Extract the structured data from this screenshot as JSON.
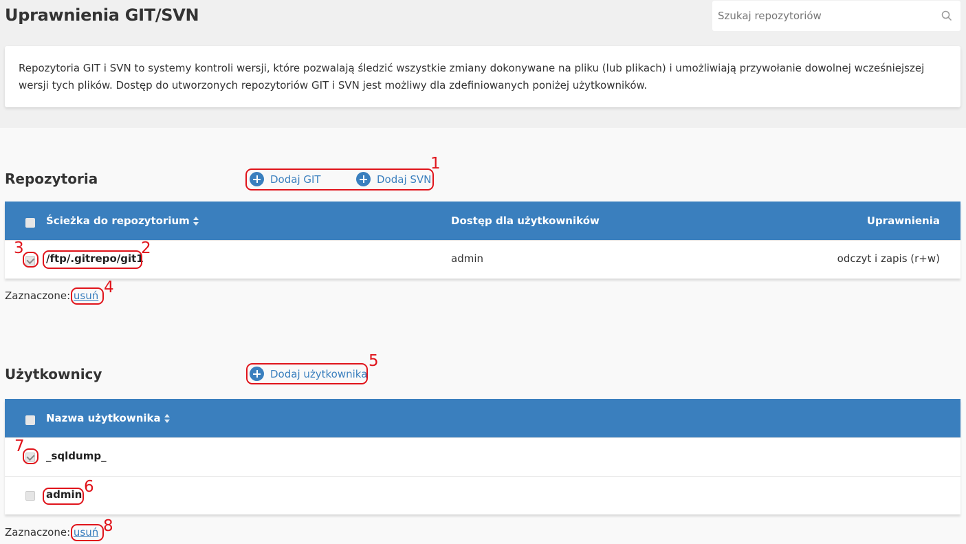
{
  "header": {
    "title": "Uprawnienia GIT/SVN",
    "search_placeholder": "Szukaj repozytoriów",
    "search_value": ""
  },
  "description": "Repozytoria GIT i SVN to systemy kontroli wersji, które pozwalają śledzić wszystkie zmiany dokonywane na pliku (lub plikach) i umożliwiają przywołanie dowolnej wcześniejszej wersji tych plików. Dostęp do utworzonych repozytoriów GIT i SVN jest możliwy dla zdefiniowanych poniżej użytkowników.",
  "repositories": {
    "title": "Repozytoria",
    "add_git": "Dodaj GIT",
    "add_svn": "Dodaj SVN",
    "columns": [
      "Ścieżka do repozytorium",
      "Dostęp dla użytkowników",
      "Uprawnienia"
    ],
    "rows": [
      {
        "path": "/ftp/.gitrepo/git1",
        "users": "admin",
        "permissions": "odczyt i zapis (r+w)",
        "checked": true
      }
    ],
    "selected_label": "Zaznaczone:",
    "delete_link": "usuń"
  },
  "users": {
    "title": "Użytkownicy",
    "add_user": "Dodaj użytkownika",
    "columns": [
      "Nazwa użytkownika"
    ],
    "rows": [
      {
        "name": "_sqldump_",
        "checked": true
      },
      {
        "name": "admin",
        "checked": false
      }
    ],
    "selected_label": "Zaznaczone:",
    "delete_link": "usuń"
  },
  "annotations": [
    "1",
    "2",
    "3",
    "4",
    "5",
    "6",
    "7",
    "8"
  ],
  "colors": {
    "accent": "#3a7fbe",
    "annotation": "#e0141b",
    "header_bg": "#f0f0f0"
  }
}
